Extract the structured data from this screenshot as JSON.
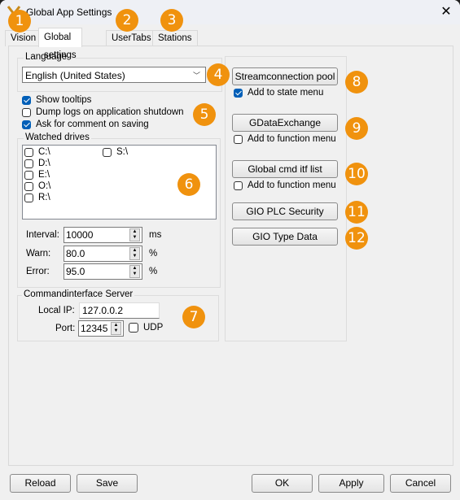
{
  "window": {
    "title": "Global App Settings",
    "close_icon": "close-icon"
  },
  "tabs": [
    {
      "label": "Vision",
      "active": false
    },
    {
      "label": "Global settings",
      "active": true
    },
    {
      "label": "UserTabs",
      "active": false
    },
    {
      "label": "Stations",
      "active": false
    }
  ],
  "language": {
    "group_label": "Language",
    "selected": "English (United States)"
  },
  "options": {
    "show_tooltips": {
      "label": "Show tooltips",
      "checked": true
    },
    "dump_logs": {
      "label": "Dump logs on application shutdown",
      "checked": false
    },
    "ask_comment": {
      "label": "Ask for comment on saving",
      "checked": true
    }
  },
  "watched_drives": {
    "group_label": "Watched drives",
    "drives": [
      {
        "label": "C:\\",
        "checked": false
      },
      {
        "label": "D:\\",
        "checked": false
      },
      {
        "label": "E:\\",
        "checked": false
      },
      {
        "label": "O:\\",
        "checked": false
      },
      {
        "label": "R:\\",
        "checked": false
      },
      {
        "label": "S:\\",
        "checked": false
      }
    ],
    "interval": {
      "label": "Interval:",
      "value": "10000",
      "unit": "ms"
    },
    "warn": {
      "label": "Warn:",
      "value": "80.0",
      "unit": "%"
    },
    "error": {
      "label": "Error:",
      "value": "95.0",
      "unit": "%"
    }
  },
  "cmd_server": {
    "group_label": "Commandinterface Server",
    "local_ip_label": "Local IP:",
    "local_ip": "127.0.0.2",
    "port_label": "Port:",
    "port": "12345",
    "udp_label": "UDP",
    "udp_checked": false
  },
  "right_panel": {
    "stream_pool": {
      "label": "Streamconnection pool",
      "option_label": "Add to state menu",
      "option_checked": true
    },
    "gdata": {
      "label": "GDataExchange",
      "option_label": "Add to function menu",
      "option_checked": false
    },
    "cmd_itf": {
      "label": "Global cmd itf list",
      "option_label": "Add to function menu",
      "option_checked": false
    },
    "plc_security": {
      "label": "GIO PLC Security"
    },
    "type_data": {
      "label": "GIO Type Data"
    }
  },
  "footer": {
    "reload": "Reload",
    "save": "Save",
    "ok": "OK",
    "apply": "Apply",
    "cancel": "Cancel"
  },
  "badges": [
    "1",
    "2",
    "3",
    "4",
    "5",
    "6",
    "7",
    "8",
    "9",
    "10",
    "11",
    "12"
  ],
  "colors": {
    "badge": "#f0920e",
    "checkbox_checked": "#005fb8"
  }
}
